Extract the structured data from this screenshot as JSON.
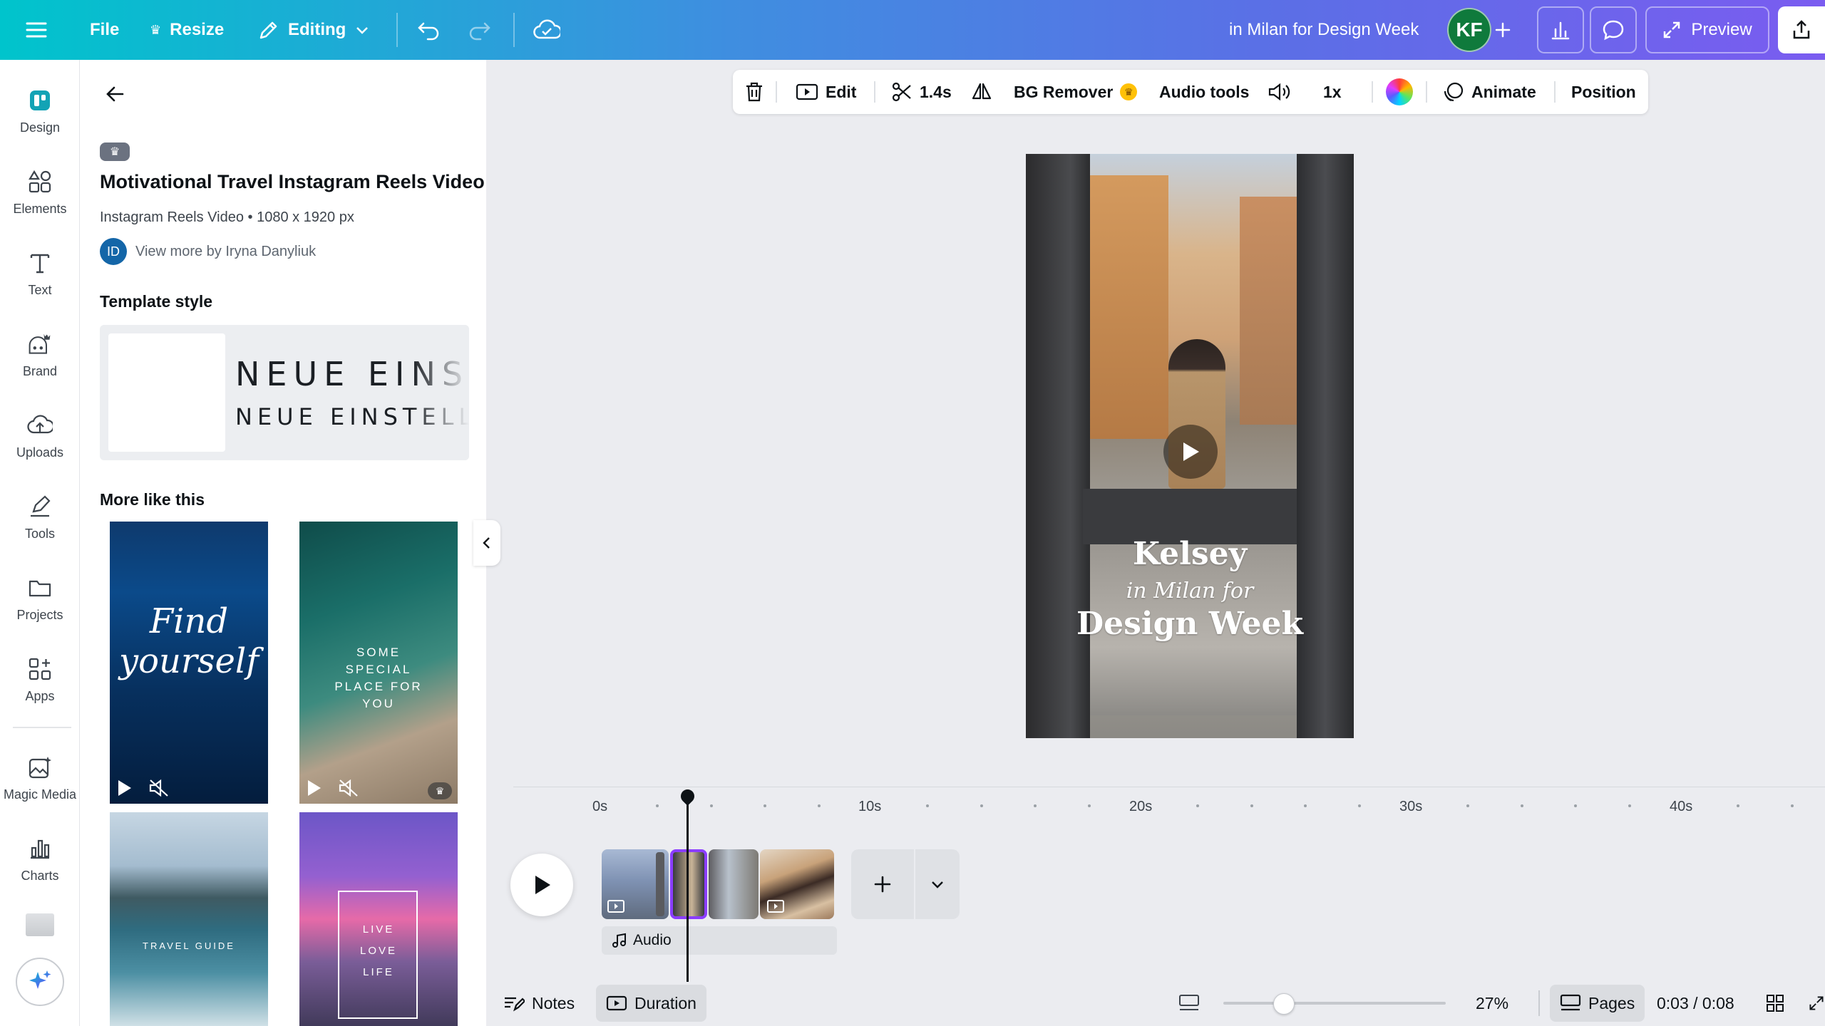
{
  "topbar": {
    "file_label": "File",
    "resize_label": "Resize",
    "editing_label": "Editing",
    "doc_title": "in Milan for Design Week",
    "avatar_initials": "KF",
    "preview_label": "Preview"
  },
  "rail": {
    "items": [
      {
        "label": "Design",
        "icon": "design-icon"
      },
      {
        "label": "Elements",
        "icon": "elements-icon"
      },
      {
        "label": "Text",
        "icon": "text-icon"
      },
      {
        "label": "Brand",
        "icon": "brand-icon"
      },
      {
        "label": "Uploads",
        "icon": "upload-cloud-icon"
      },
      {
        "label": "Tools",
        "icon": "pen-tool-icon"
      },
      {
        "label": "Projects",
        "icon": "folder-icon"
      },
      {
        "label": "Apps",
        "icon": "apps-icon"
      },
      {
        "label": "Magic Media",
        "icon": "magic-media-icon"
      },
      {
        "label": "Charts",
        "icon": "bar-chart-icon"
      }
    ]
  },
  "panel": {
    "title": "Motivational Travel Instagram Reels Video",
    "subtitle": "Instagram Reels Video • 1080 x 1920 px",
    "author_initials": "ID",
    "author_link": "View more by Iryna Danyliuk",
    "template_style_heading": "Template style",
    "font_line_1": "NEUE EINSTELLUNG",
    "font_line_2": "NEUE EINSTELLUNG",
    "more_like_this_heading": "More like this",
    "thumbnails": [
      {
        "text": "Find yourself"
      },
      {
        "text": "SOME SPECIAL PLACE FOR YOU"
      },
      {
        "text": "TRAVEL GUIDE"
      },
      {
        "text": "LIVE LOVE LIFE"
      }
    ]
  },
  "context_toolbar": {
    "edit_label": "Edit",
    "duration_label": "1.4s",
    "bg_remover_label": "BG Remover",
    "audio_tools_label": "Audio tools",
    "speed_label": "1x",
    "animate_label": "Animate",
    "position_label": "Position"
  },
  "canvas": {
    "title_line_1": "Kelsey",
    "title_line_2": "in Milan for",
    "title_line_3": "Design Week"
  },
  "timeline": {
    "ticks": [
      "0s",
      "10s",
      "20s",
      "30s",
      "40s"
    ],
    "audio_label": "Audio"
  },
  "bottombar": {
    "notes_label": "Notes",
    "duration_label": "Duration",
    "zoom_percent": "27%",
    "zoom_level": 0.27,
    "pages_label": "Pages",
    "time_display": "0:03 / 0:08"
  },
  "colors": {
    "accent_purple": "#8b3dff",
    "topbar_start": "#00c4cc",
    "topbar_end": "#7a5cf0",
    "avatar_green": "#0f7a3c"
  }
}
